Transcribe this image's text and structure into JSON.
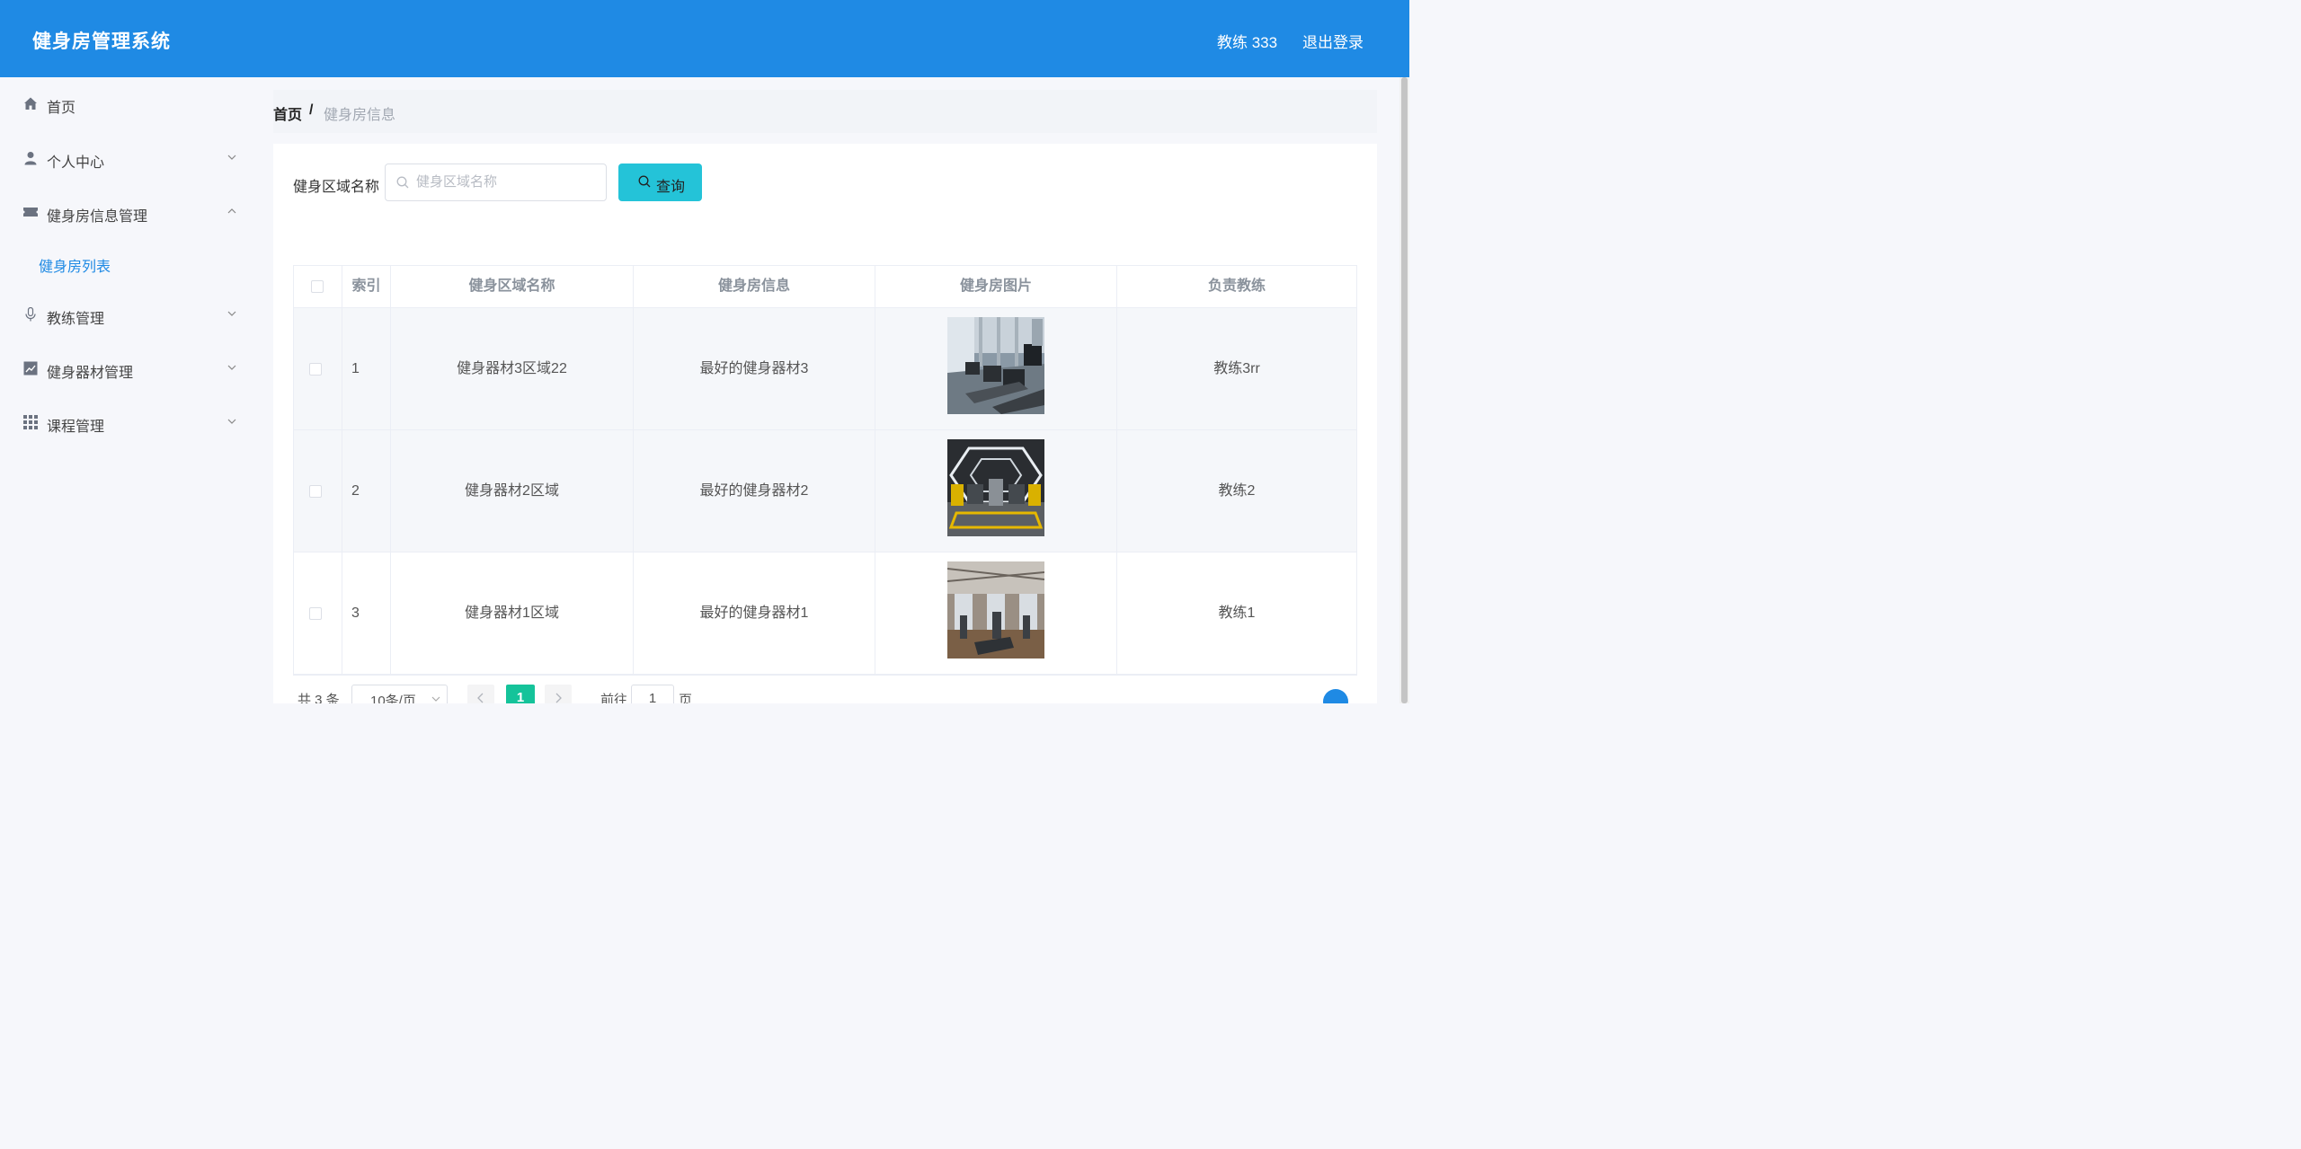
{
  "header": {
    "title": "健身房管理系统",
    "user": "教练 333",
    "logout": "退出登录"
  },
  "sidebar": {
    "items": [
      {
        "label": "首页",
        "icon": "home-icon"
      },
      {
        "label": "个人中心",
        "icon": "user-icon",
        "expanded": false
      },
      {
        "label": "健身房信息管理",
        "icon": "ticket-icon",
        "expanded": true,
        "children": [
          {
            "label": "健身房列表",
            "active": true
          }
        ]
      },
      {
        "label": "教练管理",
        "icon": "microphone-icon",
        "expanded": false
      },
      {
        "label": "健身器材管理",
        "icon": "chart-icon",
        "expanded": false
      },
      {
        "label": "课程管理",
        "icon": "grid-icon",
        "expanded": false
      }
    ]
  },
  "breadcrumb": {
    "home": "首页",
    "separator": "/",
    "current": "健身房信息"
  },
  "search": {
    "label": "健身区域名称",
    "placeholder": "健身区域名称",
    "button": "查询"
  },
  "table": {
    "columns": [
      "索引",
      "健身区域名称",
      "健身房信息",
      "健身房图片",
      "负责教练"
    ],
    "rows": [
      {
        "index": "1",
        "area": "健身器材3区域22",
        "info": "最好的健身器材3",
        "coach": "教练3rr"
      },
      {
        "index": "2",
        "area": "健身器材2区域",
        "info": "最好的健身器材2",
        "coach": "教练2"
      },
      {
        "index": "3",
        "area": "健身器材1区域",
        "info": "最好的健身器材1",
        "coach": "教练1"
      }
    ]
  },
  "pagination": {
    "total": "共 3 条",
    "page_size": "10条/页",
    "current_page": "1",
    "goto_label": "前往",
    "goto_value": "1",
    "page_suffix": "页"
  },
  "colors": {
    "header": "#1f8ae4",
    "query_button": "#24c3d8",
    "active_page": "#15c39a",
    "active_menu": "#1f8ae4"
  }
}
